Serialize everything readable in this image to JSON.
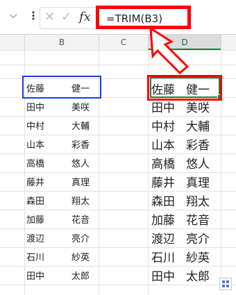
{
  "formula_bar": {
    "formula": "=TRIM(B3)",
    "fx_label": "fx",
    "cancel_glyph": "✕",
    "enter_glyph": "✓",
    "namebox_arrow": "⌵",
    "more_glyph": "⋮"
  },
  "columns": [
    {
      "label": "B",
      "selected": false
    },
    {
      "label": "C",
      "selected": false
    },
    {
      "label": "D",
      "selected": true
    }
  ],
  "column_b": [
    {
      "family": "佐藤",
      "given": "健一"
    },
    {
      "family": "田中",
      "given": "美咲"
    },
    {
      "family": "中村",
      "given": "大輔"
    },
    {
      "family": "山本",
      "given": "彩香"
    },
    {
      "family": "高橋",
      "given": "悠人"
    },
    {
      "family": "藤井",
      "given": "真理"
    },
    {
      "family": "森田",
      "given": "翔太"
    },
    {
      "family": "加藤",
      "given": "花音"
    },
    {
      "family": "渡辺",
      "given": "亮介"
    },
    {
      "family": "石川",
      "given": "紗英"
    },
    {
      "family": "田中",
      "given": "太郎"
    }
  ],
  "column_d": [
    {
      "family": "佐藤",
      "given": "健一"
    },
    {
      "family": "田中",
      "given": "美咲"
    },
    {
      "family": "中村",
      "given": "大輔"
    },
    {
      "family": "山本",
      "given": "彩香"
    },
    {
      "family": "高橋",
      "given": "悠人"
    },
    {
      "family": "藤井",
      "given": "真理"
    },
    {
      "family": "森田",
      "given": "翔太"
    },
    {
      "family": "加藤",
      "given": "花音"
    },
    {
      "family": "渡辺",
      "given": "亮介"
    },
    {
      "family": "石川",
      "given": "紗英"
    },
    {
      "family": "田中",
      "given": "太郎"
    }
  ],
  "colors": {
    "highlight_red": "#ff0000",
    "source_blue": "#1f3dd6",
    "selection_green": "#1e7d3a"
  }
}
